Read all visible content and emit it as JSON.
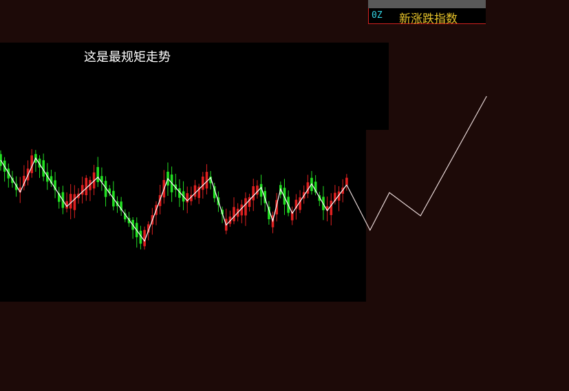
{
  "header": {
    "code": "0Z",
    "title": "新涨跌指数"
  },
  "annotation": "这是最规矩走势",
  "colors": {
    "page_bg": "#1d0a08",
    "panel_bg": "#000000",
    "up_candle": "#e02020",
    "down_candle": "#22e022",
    "zigzag_line": "#ffffff",
    "projection_line": "#e8d8d8",
    "code_text": "#33d6e6",
    "title_text": "#e6c229"
  },
  "chart_data": {
    "type": "candlestick",
    "zigzag_pivots": [
      [
        0,
        96
      ],
      [
        5,
        34
      ],
      [
        9,
        100
      ],
      [
        17,
        6
      ],
      [
        25,
        63
      ],
      [
        37,
        -61
      ],
      [
        43,
        60
      ],
      [
        48,
        17
      ],
      [
        54,
        62
      ],
      [
        58,
        -30
      ],
      [
        67,
        43
      ],
      [
        70,
        -22
      ],
      [
        72,
        40
      ],
      [
        75,
        -7
      ],
      [
        80,
        50
      ],
      [
        84,
        -2
      ],
      [
        89,
        48
      ]
    ],
    "projection": [
      [
        89,
        48
      ],
      [
        95,
        -40
      ],
      [
        100,
        33
      ],
      [
        108,
        -12
      ],
      [
        125,
        220
      ]
    ]
  }
}
